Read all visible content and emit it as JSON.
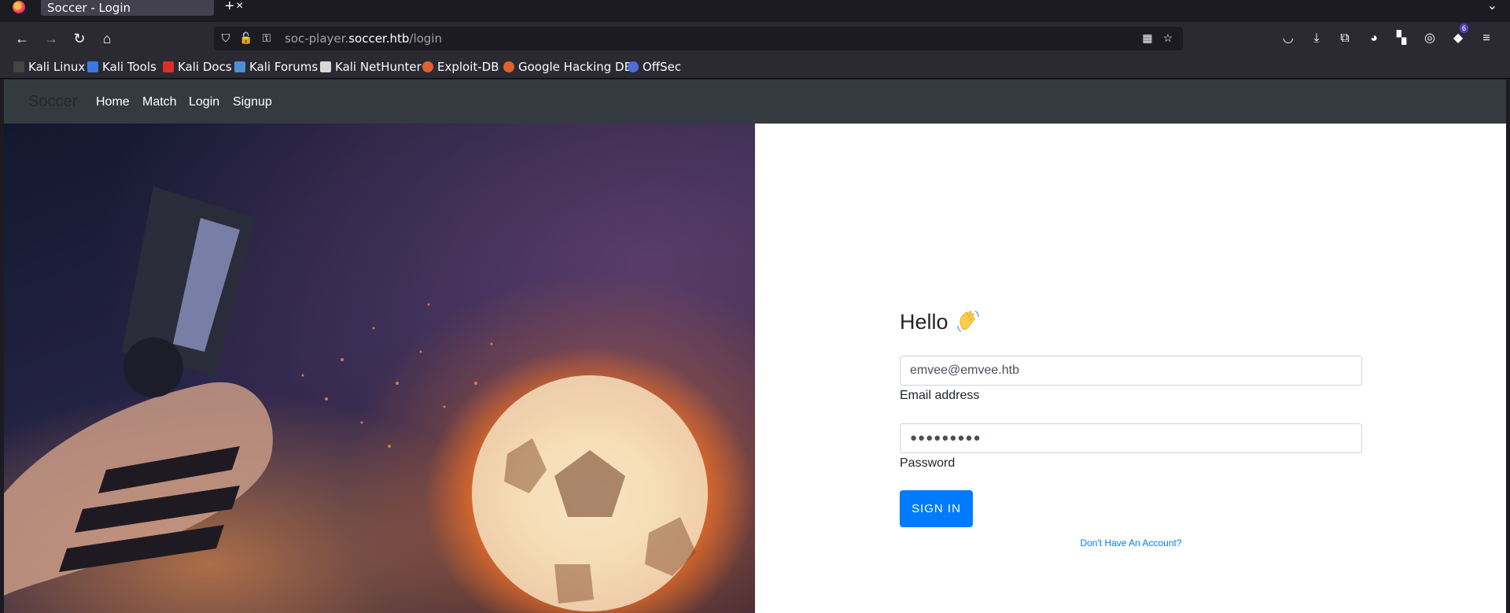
{
  "browser": {
    "tab_title": "Soccer - Login",
    "tab_close": "×",
    "new_tab": "+",
    "url": {
      "prefix": "soc-player.",
      "host": "soccer.htb",
      "path": "/login"
    },
    "extension_badge": "6",
    "bookmarks": [
      {
        "label": "Kali Linux",
        "icon": "kali-dragon-icon",
        "color": "#2a2a2a"
      },
      {
        "label": "Kali Tools",
        "icon": "kali-tools-icon",
        "color": "#3b78e7"
      },
      {
        "label": "Kali Docs",
        "icon": "kali-docs-icon",
        "color": "#d93025"
      },
      {
        "label": "Kali Forums",
        "icon": "kali-forums-icon",
        "color": "#4a90d9"
      },
      {
        "label": "Kali NetHunter",
        "icon": "nethunter-icon",
        "color": "#e8e8e8"
      },
      {
        "label": "Exploit-DB",
        "icon": "exploit-db-icon",
        "color": "#e0612b"
      },
      {
        "label": "Google Hacking DB",
        "icon": "ghdb-icon",
        "color": "#e0612b"
      },
      {
        "label": "OffSec",
        "icon": "offsec-icon",
        "color": "#4f6bd8"
      }
    ]
  },
  "site": {
    "brand": "Soccer",
    "nav": [
      "Home",
      "Match",
      "Login",
      "Signup"
    ]
  },
  "login": {
    "greeting": "Hello",
    "greeting_icon": "waving-hand-icon",
    "email_value": "emvee@emvee.htb",
    "email_label": "Email address",
    "password_mask": "●●●●●●●●●",
    "password_label": "Password",
    "submit": "SIGN IN",
    "signup_link": "Don't Have An Account?"
  },
  "colors": {
    "primary": "#007bff",
    "navbar": "#343a40"
  }
}
